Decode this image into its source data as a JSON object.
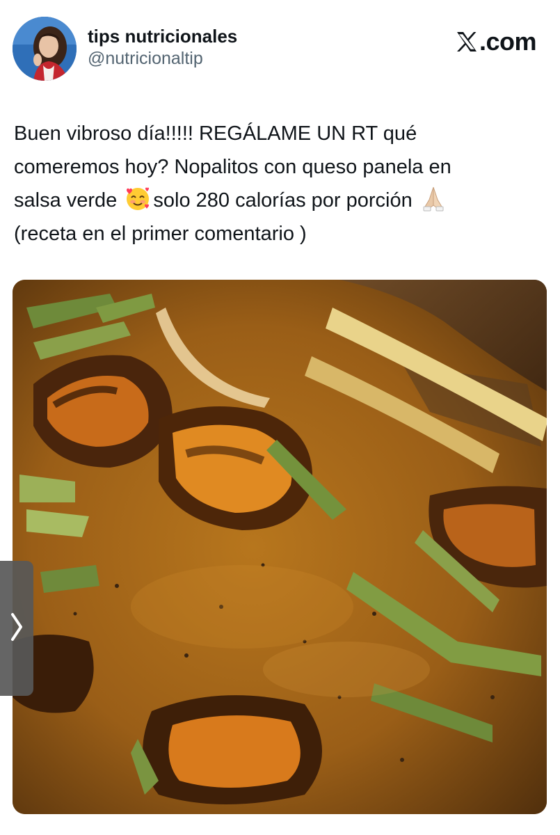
{
  "author": {
    "display_name": "tips nutricionales",
    "handle": "@nutricionaltip"
  },
  "site": {
    "brand": ".com",
    "icon": "x-logo-icon"
  },
  "tweet": {
    "lines": [
      "Buen vibroso día!!!!! REGÁLAME UN RT qué",
      "comeremos hoy? Nopalitos con queso panela en",
      "salsa verde",
      "solo 280 calorías por porción",
      "(receta en el primer comentario )"
    ],
    "emojis": [
      "smiling-face-with-hearts-icon",
      "folded-hands-icon"
    ]
  },
  "media": {
    "icon": "food-photo-image",
    "next_icon": "chevron-right-icon"
  },
  "colors": {
    "text": "#0f1419",
    "secondary": "#536471",
    "background": "#ffffff"
  }
}
